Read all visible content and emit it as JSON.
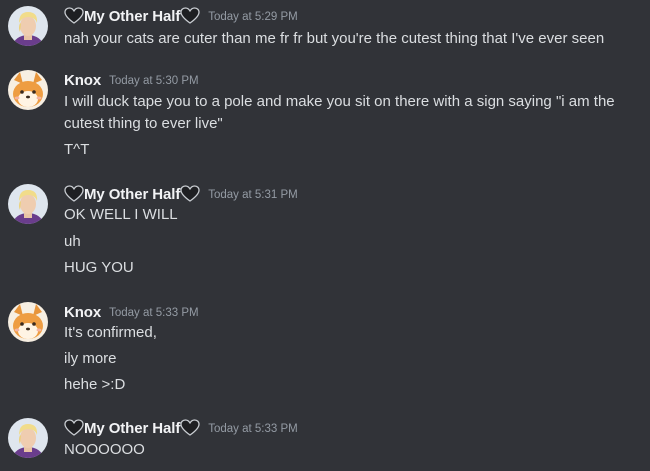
{
  "messages": [
    {
      "author": "My Other Half",
      "timestamp": "Today at 5:29 PM",
      "lines": [
        "nah your cats are cuter than me fr fr but you're the cutest thing that I've ever seen"
      ]
    },
    {
      "author": "Knox",
      "timestamp": "Today at 5:30 PM",
      "lines": [
        "I will duck tape you to a pole and make you sit on there with a sign saying \"i am the cutest thing to ever live\"",
        "T^T"
      ]
    },
    {
      "author": "My Other Half",
      "timestamp": "Today at 5:31 PM",
      "lines": [
        "OK WELL I WILL",
        "uh",
        "HUG YOU"
      ]
    },
    {
      "author": "Knox",
      "timestamp": "Today at 5:33 PM",
      "lines": [
        "It's confirmed,",
        "ily more",
        "hehe >:D"
      ]
    },
    {
      "author": "My Other Half",
      "timestamp": "Today at 5:33 PM",
      "lines": [
        "NOOOOOO"
      ]
    }
  ],
  "icons": {
    "name_decoration": "heart-outline-icon",
    "avatar_my_other_half": "blonde-person-avatar",
    "avatar_knox": "shiba-dog-avatar"
  },
  "colors": {
    "background": "#313338",
    "username": "#f2f3f5",
    "message_text": "#dbdee1",
    "timestamp": "#949ba4"
  }
}
